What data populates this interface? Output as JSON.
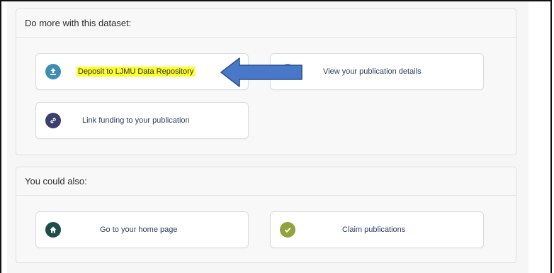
{
  "panels": {
    "more": {
      "title": "Do more with this dataset:",
      "cards": {
        "deposit": {
          "label": "Deposit to LJMU Data Repository",
          "icon": "upload-icon",
          "color": "#3f8db3",
          "highlight": "#ffff22"
        },
        "view": {
          "label": "View your publication details",
          "icon": "search-icon",
          "color": "#3aa58d"
        },
        "link": {
          "label": "Link funding to your publication",
          "icon": "link-icon",
          "color": "#3b3f6b"
        }
      }
    },
    "also": {
      "title": "You could also:",
      "cards": {
        "home": {
          "label": "Go to your home page",
          "icon": "home-icon",
          "color": "#1f4e4a"
        },
        "claim": {
          "label": "Claim publications",
          "icon": "check-icon",
          "color": "#8fa43a"
        }
      }
    }
  },
  "annotation": {
    "icon": "left-arrow-icon",
    "color": "#4a78c8"
  }
}
